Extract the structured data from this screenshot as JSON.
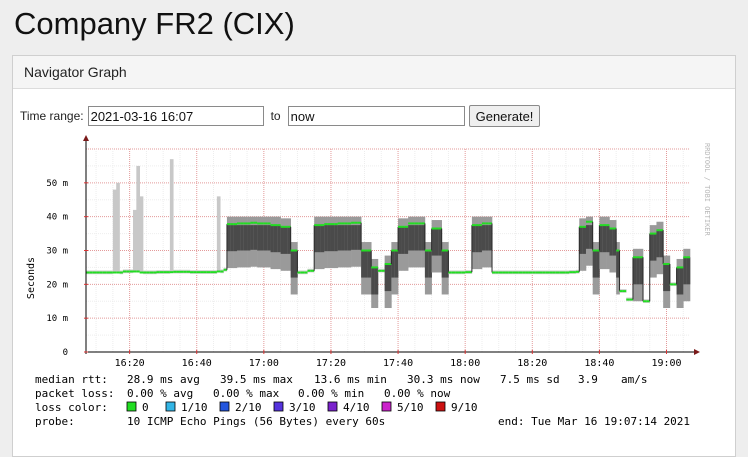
{
  "page": {
    "title": "Company FR2 (CIX)"
  },
  "panel": {
    "title": "Navigator Graph"
  },
  "form": {
    "time_range_label": "Time range:",
    "start_value": "2021-03-16 16:07",
    "to_label": "to",
    "end_value": "now",
    "generate_label": "Generate!"
  },
  "chart_data": {
    "type": "area",
    "ylabel": "Seconds",
    "y_unit_suffix": "m",
    "ylim": [
      0,
      60
    ],
    "y_ticks": [
      0,
      10,
      20,
      30,
      40,
      50
    ],
    "y_tick_labels": [
      "0",
      "10 m",
      "20 m",
      "30 m",
      "40 m",
      "50 m"
    ],
    "x_range_minutes": [
      0,
      180
    ],
    "x_ticks_minutes": [
      13,
      33,
      53,
      73,
      93,
      113,
      133,
      153,
      173
    ],
    "x_tick_labels": [
      "16:20",
      "16:40",
      "17:00",
      "17:20",
      "17:40",
      "18:00",
      "18:20",
      "18:40",
      "19:00"
    ],
    "grid": true,
    "watermark": "RRDTOOL / TOBI OETIKER",
    "median_series_ms": [
      [
        0,
        23.5
      ],
      [
        5,
        23.5
      ],
      [
        10,
        23.8
      ],
      [
        15,
        23.5
      ],
      [
        20,
        23.6
      ],
      [
        25,
        23.7
      ],
      [
        30,
        23.6
      ],
      [
        38,
        23.8
      ],
      [
        40,
        24.3
      ],
      [
        41,
        37.8
      ],
      [
        44,
        38.0
      ],
      [
        48,
        38.2
      ],
      [
        50,
        38.0
      ],
      [
        54,
        37.5
      ],
      [
        57,
        37.0
      ],
      [
        60,
        30.0
      ],
      [
        62,
        23.5
      ],
      [
        65,
        24.0
      ],
      [
        67,
        37.5
      ],
      [
        70,
        37.8
      ],
      [
        74,
        38.0
      ],
      [
        78,
        38.2
      ],
      [
        81,
        30.0
      ],
      [
        84,
        25.0
      ],
      [
        86,
        24.0
      ],
      [
        88,
        26.0
      ],
      [
        90,
        30.0
      ],
      [
        92,
        37.0
      ],
      [
        95,
        38.0
      ],
      [
        98,
        38.0
      ],
      [
        100,
        30.0
      ],
      [
        102,
        36.5
      ],
      [
        105,
        30.0
      ],
      [
        107,
        23.5
      ],
      [
        112,
        23.6
      ],
      [
        114,
        37.5
      ],
      [
        117,
        38.0
      ],
      [
        120,
        23.5
      ],
      [
        130,
        23.5
      ],
      [
        143,
        23.6
      ],
      [
        145,
        23.7
      ],
      [
        146,
        37.0
      ],
      [
        148,
        38.5
      ],
      [
        150,
        30.0
      ],
      [
        152,
        37.5
      ],
      [
        155,
        36.5
      ],
      [
        157,
        30.0
      ],
      [
        158,
        18.0
      ],
      [
        160,
        15.5
      ],
      [
        162,
        28.0
      ],
      [
        165,
        15.0
      ],
      [
        167,
        35.0
      ],
      [
        169,
        36.0
      ],
      [
        171,
        26.0
      ],
      [
        173,
        20.0
      ],
      [
        175,
        25.0
      ],
      [
        177,
        28.0
      ],
      [
        179,
        29.0
      ],
      [
        180,
        37.0
      ]
    ],
    "legend": {
      "median_rtt": {
        "label": "median rtt:",
        "avg": "28.9 ms avg",
        "max": "39.5 ms max",
        "min": "13.6 ms min",
        "now": "30.3 ms now",
        "sd": "7.5 ms sd",
        "ams": "3.9",
        "ams_unit": "am/s"
      },
      "packet_loss": {
        "label": "packet loss:",
        "avg": "0.00 % avg",
        "max": "0.00 % max",
        "min": "0.00 % min",
        "now": "0.00 % now"
      },
      "loss_color": {
        "label": "loss color:",
        "items": [
          {
            "label": "0",
            "color": "#22dd22"
          },
          {
            "label": "1/10",
            "color": "#33b5e5"
          },
          {
            "label": "2/10",
            "color": "#2255dd"
          },
          {
            "label": "3/10",
            "color": "#5533dd"
          },
          {
            "label": "4/10",
            "color": "#7a22cc"
          },
          {
            "label": "5/10",
            "color": "#cc22cc"
          },
          {
            "label": "9/10",
            "color": "#cc1111"
          }
        ]
      },
      "probe": {
        "label": "probe:",
        "value": "10 ICMP Echo Pings (56 Bytes) every 60s",
        "end": "end: Tue Mar 16 19:07:14 2021"
      }
    }
  }
}
